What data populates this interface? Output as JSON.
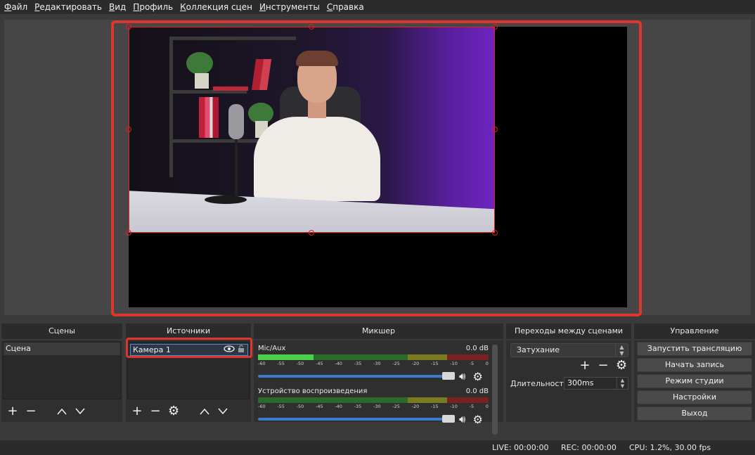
{
  "menu": [
    "Файл",
    "Редактировать",
    "Вид",
    "Профиль",
    "Коллекция сцен",
    "Инструменты",
    "Справка"
  ],
  "docks": {
    "scenes": {
      "title": "Сцены",
      "items": [
        "Сцена"
      ]
    },
    "sources": {
      "title": "Источники",
      "items": [
        {
          "label": "Камера 1"
        }
      ]
    },
    "mixer": {
      "title": "Микшер",
      "channels": [
        {
          "name": "Mic/Aux",
          "db": "0.0 dB",
          "level": 0.24
        },
        {
          "name": "Устройство воспроизведения",
          "db": "0.0 dB",
          "level": 0.0
        }
      ],
      "ticks": [
        "-60",
        "-55",
        "-50",
        "-45",
        "-40",
        "-35",
        "-30",
        "-25",
        "-20",
        "-15",
        "-10",
        "-5",
        "0"
      ]
    },
    "transitions": {
      "title": "Переходы между сценами",
      "selected": "Затухание",
      "duration_label": "Длительность",
      "duration_value": "300ms"
    },
    "controls": {
      "title": "Управление",
      "buttons": [
        "Запустить трансляцию",
        "Начать запись",
        "Режим студии",
        "Настройки",
        "Выход"
      ]
    }
  },
  "status": {
    "live": "LIVE: 00:00:00",
    "rec": "REC: 00:00:00",
    "cpu": "CPU: 1.2%, 30.00 fps"
  },
  "colors": {
    "highlight": "#e0352b",
    "selection": "#4a8fd6",
    "meter_green": "#4cd04c"
  }
}
